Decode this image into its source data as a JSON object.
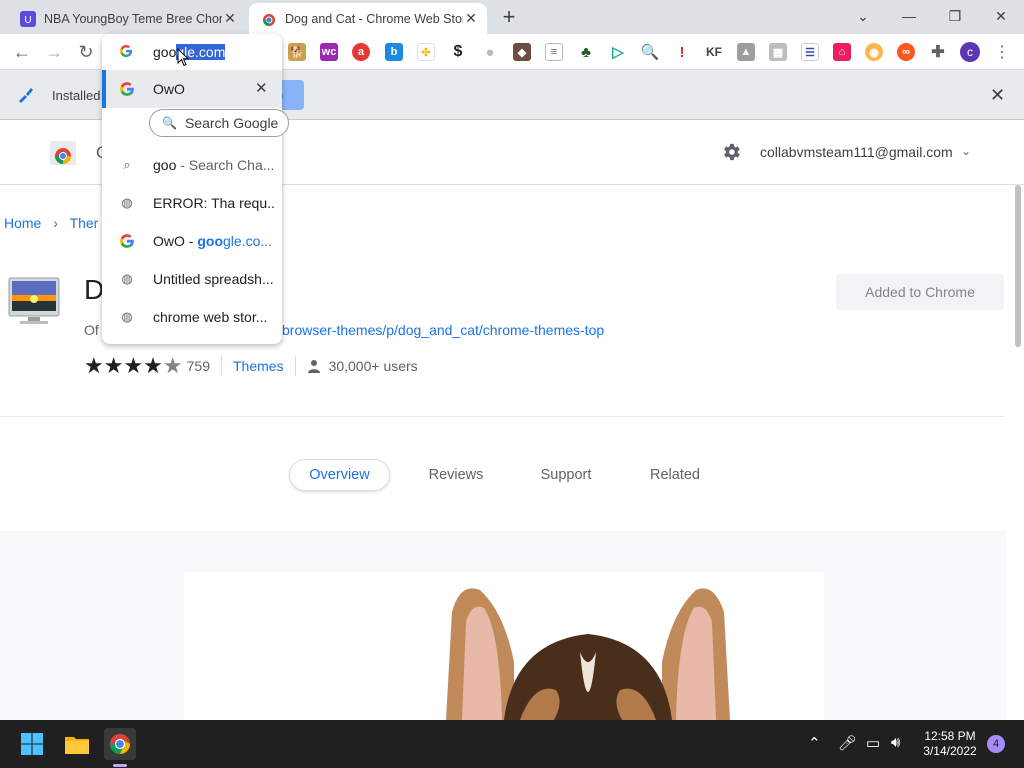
{
  "browser": {
    "tabs": [
      {
        "title": "NBA YoungBoy Teme Bree Chome",
        "active": false
      },
      {
        "title": "Dog and Cat - Chrome Web Store",
        "active": true
      }
    ],
    "new_tab": "+",
    "window_controls": {
      "tab_search": "⌄",
      "minimize": "—",
      "maximize": "❐",
      "close": "✕"
    }
  },
  "toolbar": {
    "extensions": [
      "doge",
      "wc",
      "ask",
      "b",
      "grid",
      "$",
      "moon",
      "pokemon",
      "doc",
      "shamrock",
      "play",
      "search",
      "i",
      "KF",
      "image",
      "grid2",
      "stripes",
      "camera",
      "owl",
      "infinity",
      "puzzle"
    ],
    "profile_initial": "c"
  },
  "infobar": {
    "label": "Installed",
    "button_partial": "p"
  },
  "omnibox": {
    "typed_prefix": "goo",
    "selected_suffix": "gle.com",
    "suggestions": [
      {
        "type": "google",
        "text": "OwO",
        "removable": true
      },
      {
        "type": "search",
        "text": "goo",
        "suffix": " - Search Cha..."
      },
      {
        "type": "globe",
        "text": "ERROR: Tha requ..."
      },
      {
        "type": "google",
        "text": "OwO - ",
        "bold": "goo",
        "suffix": "gle.co..."
      },
      {
        "type": "globe",
        "text": "Untitled spreadsh..."
      },
      {
        "type": "globe",
        "text": "chrome web stor..."
      }
    ],
    "search_chip": "Search Google"
  },
  "page": {
    "logo_letter": "C",
    "account": "collabvmsteam111@gmail.com",
    "breadcrumb": {
      "home": "Home",
      "next": "Ther"
    },
    "title": "D",
    "offered_by": "Of",
    "offered_link": "browser-themes/p/dog_and_cat/chrome-themes-top",
    "added_button": "Added to Chrome",
    "rating": {
      "stars": 4.5,
      "count": "759"
    },
    "category": "Themes",
    "users": "30,000+ users",
    "tabs": [
      "Overview",
      "Reviews",
      "Support",
      "Related"
    ]
  },
  "taskbar": {
    "time": "12:58 PM",
    "date": "3/14/2022",
    "notifications": "4"
  },
  "colors": {
    "accent": "#1a73e8",
    "taskbar": "#202020",
    "selection": "#3367d6"
  }
}
